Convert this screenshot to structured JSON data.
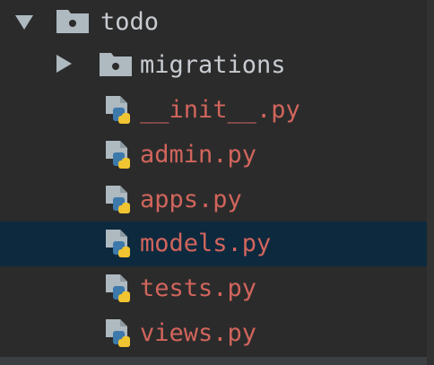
{
  "tree": {
    "root": {
      "label": "todo",
      "expanded": true,
      "icon": "folder-icon"
    },
    "subfolder": {
      "label": "migrations",
      "expanded": false,
      "icon": "folder-icon"
    },
    "files": [
      {
        "label": "__init__.py",
        "icon": "python-file-icon",
        "selected": false
      },
      {
        "label": "admin.py",
        "icon": "python-file-icon",
        "selected": false
      },
      {
        "label": "apps.py",
        "icon": "python-file-icon",
        "selected": false
      },
      {
        "label": "models.py",
        "icon": "python-file-icon",
        "selected": true
      },
      {
        "label": "tests.py",
        "icon": "python-file-icon",
        "selected": false
      },
      {
        "label": "views.py",
        "icon": "python-file-icon",
        "selected": false
      }
    ]
  },
  "colors": {
    "background": "#2b2b2b",
    "selection": "#0d293e",
    "directory_text": "#c8ccd2",
    "file_text_modified": "#d1655c",
    "folder_icon": "#aeb9c0",
    "python_blue": "#3d79ab",
    "python_yellow": "#f0c531"
  }
}
